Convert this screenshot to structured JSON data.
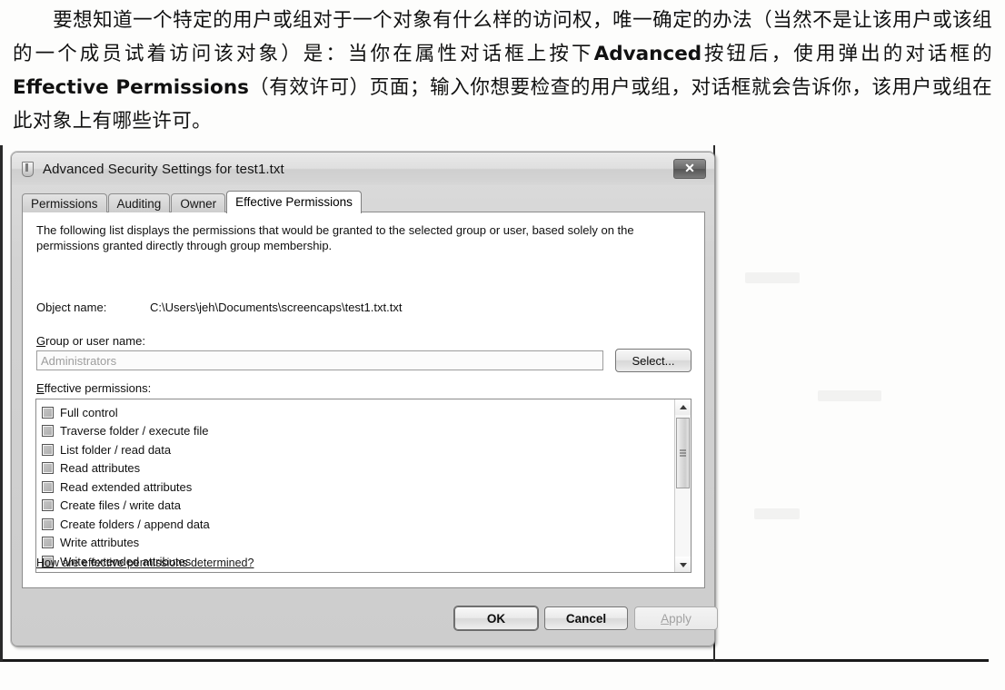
{
  "page": {
    "body_text": {
      "line1_indent": "　　",
      "para_parts": [
        {
          "t": "要想知道一个特定的用户或组对于一个对象有什么样的访问权，唯一确定的办法（当然不是让该用户或该组的一个成员试着访问该对象）是：当你在属性对话框上按下",
          "bold": false
        },
        {
          "t": "Advanced",
          "bold": true
        },
        {
          "t": "按钮后，使用弹出的对话框的",
          "bold": false
        },
        {
          "t": "Effective Permissions",
          "bold": true
        },
        {
          "t": "（有效许可）页面；输入你想要检查的用户或组，对话框就会告诉你，该用户或组在此对象上有哪些许可。",
          "bold": false
        }
      ]
    }
  },
  "dialog": {
    "title": "Advanced Security Settings for test1.txt",
    "close_label": "✕",
    "tabs": [
      {
        "label": "Permissions",
        "active": false
      },
      {
        "label": "Auditing",
        "active": false
      },
      {
        "label": "Owner",
        "active": false
      },
      {
        "label": "Effective Permissions",
        "active": true
      }
    ],
    "intro": "The following list displays the permissions that would be granted to the selected group or user, based solely on the permissions granted directly through group membership.",
    "object_name_label": "Object name:",
    "object_name_value": "C:\\Users\\jeh\\Documents\\screencaps\\test1.txt.txt",
    "group_label_accel": "G",
    "group_label_rest": "roup or user name:",
    "group_value": "Administrators",
    "select_label": "Select...",
    "eff_label_accel": "E",
    "eff_label_rest": "ffective permissions:",
    "permissions": [
      {
        "label": "Full control",
        "checked": true
      },
      {
        "label": "Traverse folder / execute file",
        "checked": true
      },
      {
        "label": "List folder / read data",
        "checked": true
      },
      {
        "label": "Read attributes",
        "checked": true
      },
      {
        "label": "Read extended attributes",
        "checked": true
      },
      {
        "label": "Create files / write data",
        "checked": true
      },
      {
        "label": "Create folders / append data",
        "checked": true
      },
      {
        "label": "Write attributes",
        "checked": true
      },
      {
        "label": "Write extended attributes",
        "checked": true
      }
    ],
    "help_link": "How are effective permissions determined?",
    "buttons": {
      "ok": "OK",
      "cancel": "Cancel",
      "apply_accel": "A",
      "apply_rest": "pply"
    },
    "scrollbar": {
      "up_arrow": "▲",
      "down_arrow": "▼"
    }
  },
  "colors": {
    "dialog_face": "#cfcfca",
    "panel_bg": "#fdfdfc",
    "text": "#141414",
    "disabled_text": "#9c9c98"
  }
}
